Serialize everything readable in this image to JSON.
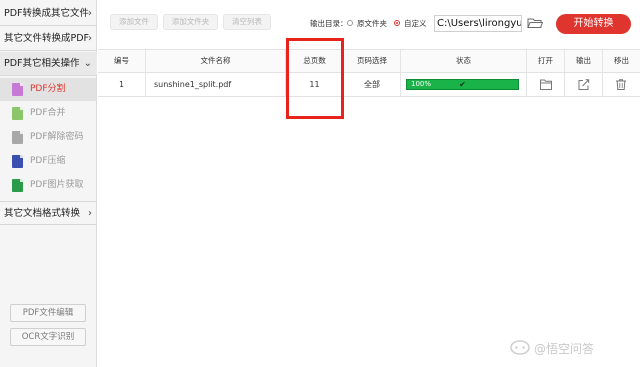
{
  "sidebar": {
    "categories": [
      {
        "label": "PDF转换成其它文件",
        "chevron": "›"
      },
      {
        "label": "其它文件转换成PDF",
        "chevron": "›"
      },
      {
        "label": "PDF其它相关操作",
        "chevron": "⌄"
      },
      {
        "label": "其它文档格式转换",
        "chevron": "›"
      }
    ],
    "items": [
      {
        "label": "PDF分割",
        "icon": "pdf-split-icon",
        "color": "#c67ad6"
      },
      {
        "label": "PDF合并",
        "icon": "pdf-merge-icon",
        "color": "#8cc66b"
      },
      {
        "label": "PDF解除密码",
        "icon": "pdf-unlock-icon",
        "color": "#a8a8a8"
      },
      {
        "label": "PDF压缩",
        "icon": "pdf-compress-icon",
        "color": "#3a4fb0"
      },
      {
        "label": "PDF图片获取",
        "icon": "pdf-image-icon",
        "color": "#2b9a49"
      }
    ],
    "bottom_buttons": [
      "PDF文件编辑",
      "OCR文字识别"
    ]
  },
  "toolbar": {
    "add_file": "添加文件",
    "add_folder": "添加文件夹",
    "clear_list": "清空列表",
    "output_label": "输出目录：",
    "radio_source": "原文件夹",
    "radio_custom": "自定义",
    "path_value": "C:\\Users\\lirongyu",
    "start_button": "开始转换"
  },
  "table": {
    "headers": [
      "编号",
      "文件名称",
      "总页数",
      "页码选择",
      "状态",
      "打开",
      "输出",
      "移出"
    ],
    "rows": [
      {
        "index": "1",
        "filename": "sunshine1_split.pdf",
        "pages": "11",
        "page_select": "全部",
        "status": "100%",
        "progress": 1.0
      }
    ]
  },
  "watermark": {
    "text": "@悟空问答"
  },
  "colors": {
    "accent": "#e0342f",
    "progress": "#19b34a",
    "highlight": "#e8231b"
  }
}
